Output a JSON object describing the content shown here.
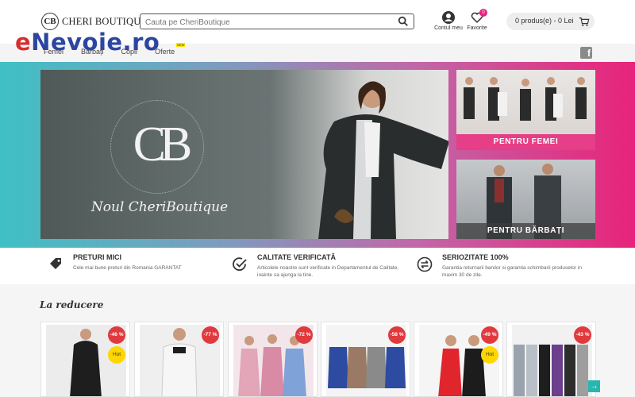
{
  "header": {
    "brand": "CHERI BOUTIQUE",
    "brand_mark": "CB",
    "search_placeholder": "Cauta pe CheriBoutique",
    "account_label": "Contul meu",
    "favorites_label": "Favorite",
    "favorites_count": "0",
    "cart_text": "0 produs(e) - 0 Lei"
  },
  "nav": {
    "items": [
      "Femei",
      "Bărbați",
      "Copii",
      "Oferte"
    ],
    "new_badge": "NEW"
  },
  "watermark": {
    "prefix": "e",
    "rest": "Nevoie.ro"
  },
  "hero": {
    "logo_text": "CB",
    "tagline": "Noul CheriBoutique"
  },
  "promos": {
    "women": "PENTRU FEMEI",
    "men": "PENTRU BĂRBAȚI"
  },
  "features": [
    {
      "title": "PRETURI MICI",
      "desc": "Cele mai bune preturi din Romania GARANTAT"
    },
    {
      "title": "CALITATE VERIFICATĂ",
      "desc": "Articolele noastre sunt verificate in Departamentul de Calitate, inainte sa ajunga la tine."
    },
    {
      "title": "SERIOZITATE 100%",
      "desc": "Garantia returnarii banilor si garantia schimbarii produselor in maxim 30 de zile."
    }
  ],
  "sale": {
    "title": "La reducere",
    "products": [
      {
        "discount": "-46 %",
        "hot": "Hot"
      },
      {
        "discount": "-77 %",
        "hot": ""
      },
      {
        "discount": "-72 %",
        "hot": ""
      },
      {
        "discount": "-58 %",
        "hot": ""
      },
      {
        "discount": "-49 %",
        "hot": "Hot"
      },
      {
        "discount": "-43 %",
        "hot": ""
      }
    ],
    "next_arrow": "→"
  },
  "colors": {
    "accent_pink": "#e8237a",
    "accent_teal": "#3fc0c4",
    "discount_red": "#e03a3e",
    "hot_yellow": "#ffd600"
  }
}
